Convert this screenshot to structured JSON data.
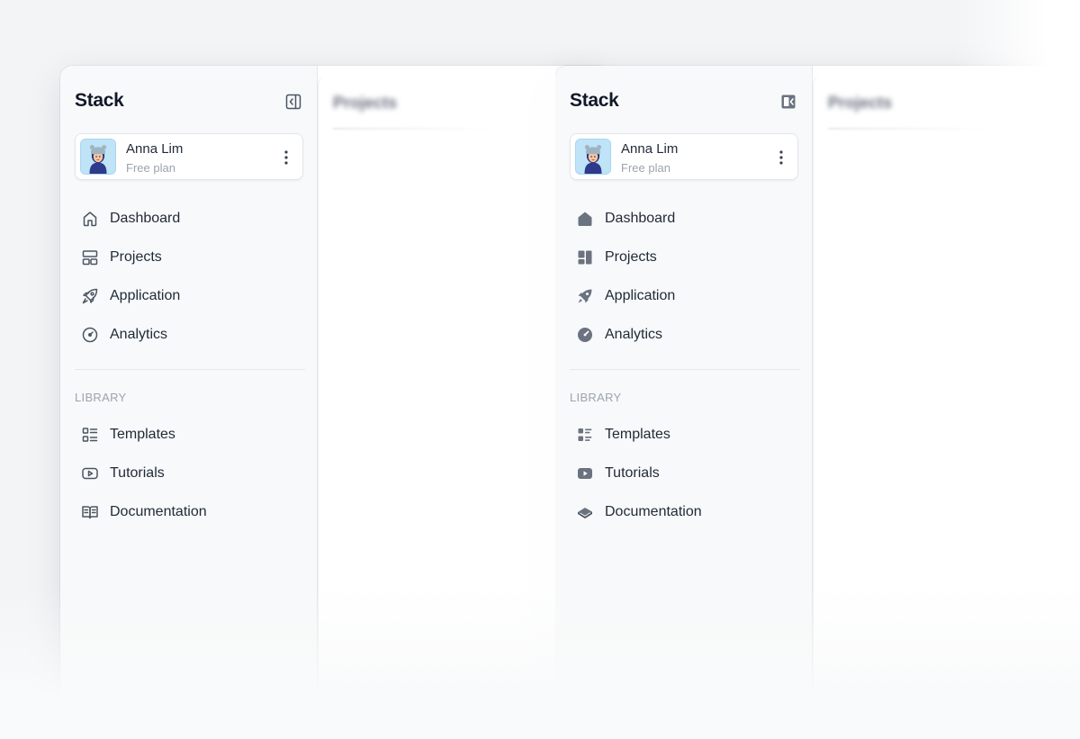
{
  "brand": "Stack",
  "user": {
    "name": "Anna Lim",
    "plan": "Free plan"
  },
  "section_label": "LIBRARY",
  "content_title": "Projects",
  "variants": [
    {
      "icon_style": "outline",
      "collapse_icon": "sidebar-collapse-outline-icon",
      "nav_main": [
        {
          "label": "Dashboard",
          "icon": "home-outline-icon"
        },
        {
          "label": "Projects",
          "icon": "layout-outline-icon"
        },
        {
          "label": "Application",
          "icon": "rocket-outline-icon"
        },
        {
          "label": "Analytics",
          "icon": "gauge-outline-icon"
        }
      ],
      "nav_library": [
        {
          "label": "Templates",
          "icon": "list-outline-icon"
        },
        {
          "label": "Tutorials",
          "icon": "video-outline-icon"
        },
        {
          "label": "Documentation",
          "icon": "book-outline-icon"
        }
      ]
    },
    {
      "icon_style": "solid",
      "collapse_icon": "sidebar-collapse-solid-icon",
      "nav_main": [
        {
          "label": "Dashboard",
          "icon": "home-solid-icon"
        },
        {
          "label": "Projects",
          "icon": "layout-solid-icon"
        },
        {
          "label": "Application",
          "icon": "rocket-solid-icon"
        },
        {
          "label": "Analytics",
          "icon": "gauge-solid-icon"
        }
      ],
      "nav_library": [
        {
          "label": "Templates",
          "icon": "list-solid-icon"
        },
        {
          "label": "Tutorials",
          "icon": "video-solid-icon"
        },
        {
          "label": "Documentation",
          "icon": "book-solid-icon"
        }
      ]
    }
  ],
  "colors": {
    "text": "#1f2937",
    "muted": "#9ca3af",
    "icon": "#4b5563",
    "icon_solid": "#6b7280",
    "avatar_bg": "#bfe3f7"
  }
}
